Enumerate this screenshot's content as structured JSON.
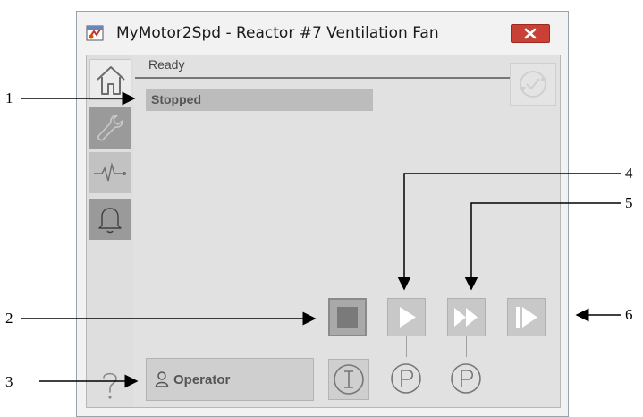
{
  "window": {
    "title": "MyMotor2Spd - Reactor #7 Ventilation Fan"
  },
  "status": {
    "ready": "Ready",
    "state": "Stopped"
  },
  "bottom": {
    "operator_label": "Operator"
  },
  "callouts": [
    "1",
    "2",
    "3",
    "4",
    "5",
    "6"
  ],
  "icons": {
    "app": "faceplate-app-icon",
    "close": "close-icon",
    "home": "home-icon",
    "maintenance": "wrench-icon",
    "trends": "trend-pulse-icon",
    "alarms": "bell-icon",
    "help": "question-icon",
    "reset": "refresh-check-icon",
    "stop": "stop-square-icon",
    "run_speed1": "play-icon",
    "run_speed2": "fast-forward-icon",
    "jog": "step-play-icon",
    "operator": "user-icon",
    "interlock": "interlock-i-icon",
    "permissive": "permissive-p-icon"
  },
  "colors": {
    "close_button": "#c94036",
    "command_arrow": "#ffffff",
    "stop_square": "#7a7a7a"
  }
}
